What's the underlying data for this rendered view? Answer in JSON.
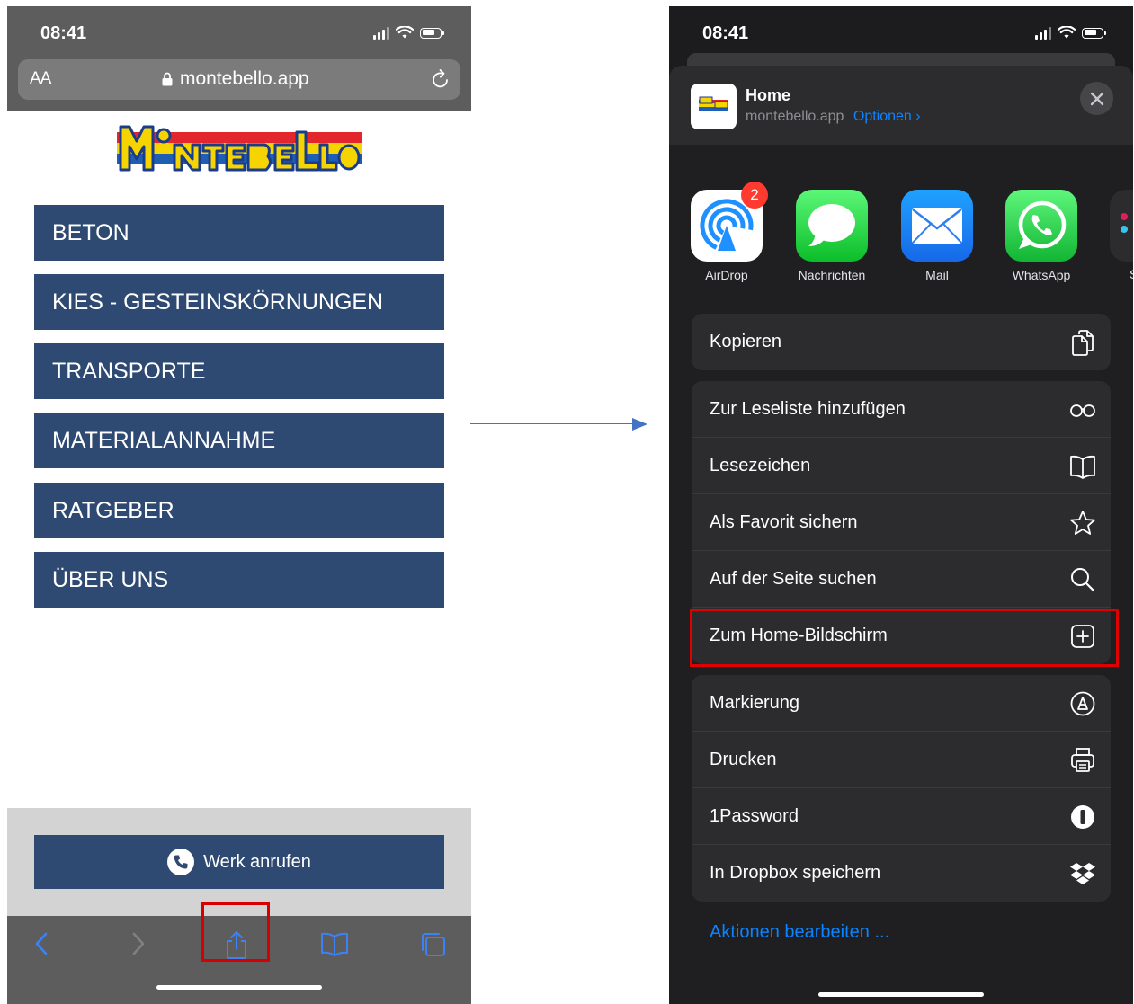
{
  "left_phone": {
    "status": {
      "time": "08:41"
    },
    "address_bar": {
      "text_size_label": "AA",
      "url": "montebello.app"
    },
    "logo_text": "MONTEBELLO",
    "menu": [
      {
        "label": "BETON"
      },
      {
        "label": "KIES - GESTEINSKÖRNUNGEN"
      },
      {
        "label": "TRANSPORTE"
      },
      {
        "label": "MATERIALANNAHME"
      },
      {
        "label": "RATGEBER"
      },
      {
        "label": "ÜBER UNS"
      }
    ],
    "call_button": {
      "label": "Werk anrufen"
    },
    "toolbar": {
      "icons": [
        "back-icon",
        "forward-icon",
        "share-icon",
        "bookmarks-icon",
        "tabs-icon"
      ]
    }
  },
  "right_phone": {
    "status": {
      "time": "08:41"
    },
    "share_header": {
      "title": "Home",
      "url": "montebello.app",
      "options_label": "Optionen ›"
    },
    "apps": [
      {
        "label": "AirDrop",
        "badge": "2"
      },
      {
        "label": "Nachrichten"
      },
      {
        "label": "Mail"
      },
      {
        "label": "WhatsApp"
      }
    ],
    "partial_app_label": "S",
    "action_groups": [
      [
        {
          "label": "Kopieren",
          "icon": "copy-icon"
        }
      ],
      [
        {
          "label": "Zur Leseliste hinzufügen",
          "icon": "glasses-icon"
        },
        {
          "label": "Lesezeichen",
          "icon": "book-icon"
        },
        {
          "label": "Als Favorit sichern",
          "icon": "star-icon"
        },
        {
          "label": "Auf der Seite suchen",
          "icon": "search-icon"
        },
        {
          "label": "Zum Home-Bildschirm",
          "icon": "add-square-icon"
        }
      ],
      [
        {
          "label": "Markierung",
          "icon": "markup-icon"
        },
        {
          "label": "Drucken",
          "icon": "printer-icon"
        },
        {
          "label": "1Password",
          "icon": "onepassword-icon"
        },
        {
          "label": "In Dropbox speichern",
          "icon": "dropbox-icon"
        }
      ]
    ],
    "edit_actions_label": "Aktionen bearbeiten ..."
  },
  "colors": {
    "button_blue": "#2e4a72",
    "highlight_red": "#e00000",
    "arrow_blue": "#4472c4",
    "ios_link_blue": "#0a84ff"
  }
}
